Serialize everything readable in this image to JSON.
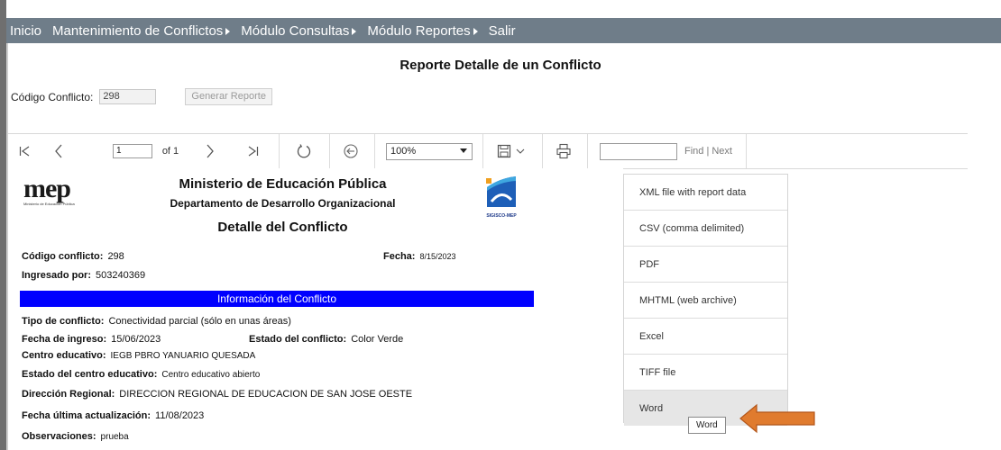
{
  "nav": {
    "items": [
      {
        "label": "Inicio",
        "has_arrow": false
      },
      {
        "label": "Mantenimiento de Conflictos",
        "has_arrow": true
      },
      {
        "label": "Módulo Consultas",
        "has_arrow": true
      },
      {
        "label": "Módulo Reportes",
        "has_arrow": true
      },
      {
        "label": "Salir",
        "has_arrow": false
      }
    ]
  },
  "page": {
    "title": "Reporte Detalle de un Conflicto"
  },
  "form": {
    "codigo_label": "Código Conflicto:",
    "codigo_value": "298",
    "generate_label": "Generar Reporte"
  },
  "toolbar": {
    "page_value": "1",
    "of_text": "of 1",
    "zoom_value": "100%",
    "find_label": "Find | Next",
    "icons": [
      "first-page-icon",
      "prev-page-icon",
      "next-page-icon",
      "last-page-icon",
      "refresh-icon",
      "back-icon",
      "save-icon",
      "print-icon"
    ]
  },
  "report": {
    "logo_text": "mep",
    "logo_sub": "Ministerio de Educación Pública",
    "ministry": "Ministerio de Educación Pública",
    "department": "Departamento de Desarrollo Organizacional",
    "heading": "Detalle del Conflicto",
    "sigisco_text": "SIGISCO-MEP",
    "codigo_label": "Código conflicto:",
    "codigo_value": "298",
    "fecha_label": "Fecha:",
    "fecha_value": "8/15/2023",
    "ingresado_label": "Ingresado por:",
    "ingresado_value": "503240369",
    "info_bar": "Información del Conflicto",
    "tipo_label": "Tipo de conflicto:",
    "tipo_value": "Conectividad parcial (sólo en unas áreas)",
    "fecha_ingreso_label": "Fecha de ingreso:",
    "fecha_ingreso_value": "15/06/2023",
    "estado_conflicto_label": "Estado del conflicto:",
    "estado_conflicto_value": "Color Verde",
    "centro_label": "Centro educativo:",
    "centro_value": "IEGB PBRO YANUARIO QUESADA",
    "estado_centro_label": "Estado del centro educativo:",
    "estado_centro_value": "Centro educativo abierto",
    "direccion_label": "Dirección Regional:",
    "direccion_value": "DIRECCION REGIONAL DE EDUCACION DE SAN JOSE OESTE",
    "actualizacion_label": "Fecha última actualización:",
    "actualizacion_value": "11/08/2023",
    "observaciones_label": "Observaciones:",
    "observaciones_value": "prueba"
  },
  "export_menu": {
    "items": [
      {
        "label": "XML file with report data"
      },
      {
        "label": "CSV (comma delimited)"
      },
      {
        "label": "PDF"
      },
      {
        "label": "MHTML (web archive)"
      },
      {
        "label": "Excel"
      },
      {
        "label": "TIFF file"
      },
      {
        "label": "Word"
      }
    ],
    "tooltip": "Word"
  },
  "colors": {
    "navbar": "#6f7d89",
    "info_bar": "#0000ff",
    "arrow": "#e07b2e",
    "arrow_border": "#b3561a"
  }
}
